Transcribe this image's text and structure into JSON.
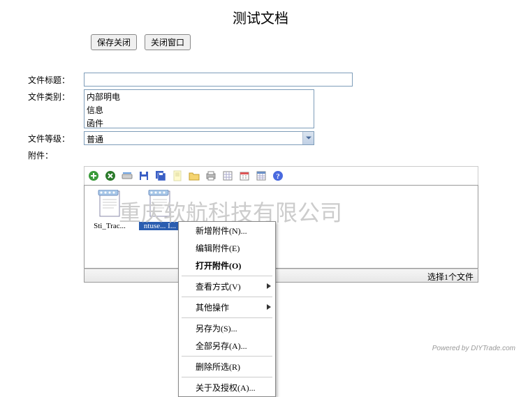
{
  "title": "测试文档",
  "buttons": {
    "save_close": "保存关闭",
    "close_window": "关闭窗口"
  },
  "form": {
    "title_label": "文件标题：",
    "title_value": "",
    "category_label": "文件类别：",
    "category_options": [
      "内部明电",
      "信息",
      "函件"
    ],
    "level_label": "文件等级：",
    "level_value": "普通",
    "attachment_label": "附件："
  },
  "toolbar_icons": [
    "add-icon",
    "delete-icon",
    "scan-icon",
    "save-icon",
    "saveall-icon",
    "doc-icon",
    "open-icon",
    "print-icon",
    "spreadsheet-icon",
    "calendar-icon",
    "grid-icon",
    "help-icon"
  ],
  "files": [
    {
      "name": "Sti_Trac...",
      "selected": false,
      "type": "notepad"
    },
    {
      "name": "ntuse... I...",
      "selected": true,
      "type": "notepad"
    }
  ],
  "status_bar": "选择1个文件",
  "context_menu": {
    "items": [
      {
        "label": "新增附件(N)...",
        "type": "item"
      },
      {
        "label": "编辑附件(E)",
        "type": "item"
      },
      {
        "label": "打开附件(O)",
        "type": "item",
        "bold": true
      },
      {
        "type": "sep"
      },
      {
        "label": "查看方式(V)",
        "type": "submenu"
      },
      {
        "type": "sep"
      },
      {
        "label": "其他操作",
        "type": "submenu"
      },
      {
        "type": "sep"
      },
      {
        "label": "另存为(S)...",
        "type": "item"
      },
      {
        "label": "全部另存(A)...",
        "type": "item"
      },
      {
        "type": "sep"
      },
      {
        "label": "删除所选(R)",
        "type": "item"
      },
      {
        "type": "sep"
      },
      {
        "label": "关于及授权(A)...",
        "type": "item"
      }
    ]
  },
  "watermark": "重庆软航科技有限公司",
  "footer": "Powered by DIYTrade.com"
}
